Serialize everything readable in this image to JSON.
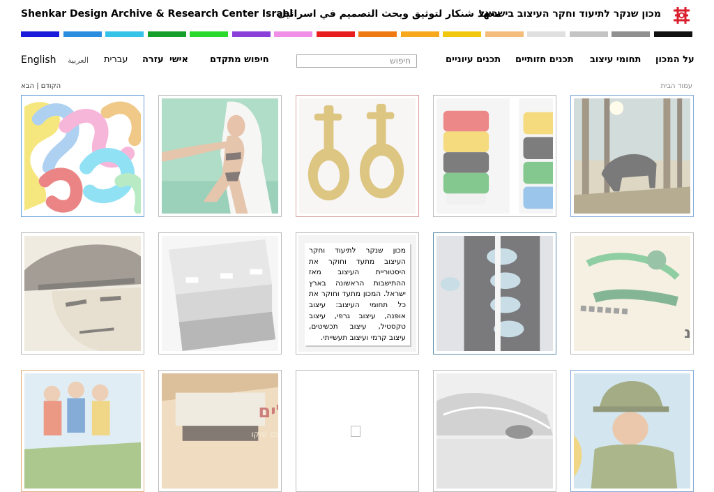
{
  "header": {
    "title_en": "Shenkar Design Archive & Research Center Israel",
    "title_ar": "معهد شنكار لتوثيق وبحث التصميم في اسرائيل",
    "title_he": "מכון שנקר לתיעוד וחקר העיצוב בישראל",
    "logo_icon": "shenkar-logo-icon",
    "logo_color": "#d81e2b"
  },
  "color_bar": [
    "#1a1adb",
    "#2b8de0",
    "#35c3e8",
    "#15a02c",
    "#2bd92b",
    "#8a3fd9",
    "#f08ee8",
    "#e81e1e",
    "#f07a12",
    "#f7a81c",
    "#f2c80f",
    "#f5bd7b",
    "#e0e0e0",
    "#c4c4c4",
    "#909090",
    "#111111"
  ],
  "nav": {
    "languages": [
      "English",
      "العربية",
      "עברית"
    ],
    "help": "עזרה",
    "personal": "אישי",
    "advanced_search": "חיפוש מתקדם",
    "search_placeholder": "חיפוש",
    "menu": [
      "על המכון",
      "תחומי עיצוב",
      "תכנים חזותיים",
      "תכנים עיוניים"
    ]
  },
  "pager": {
    "prev": "הקודם",
    "separator": "|",
    "next": "הבא"
  },
  "breadcrumb": "עמוד הבית",
  "intro_text": "מכון שנקר לתיעוד וחקר העיצוב מתעד וחוקר את היסטוריית העיצוב מאז ההתישבות הראשונה בארץ ישראל. המכון מתעד וחוקר את כל תחומי העיצוב: עיצוב אופנה, עיצוב גרפי, עיצוב טקסטיל, עיצוב תכשיטים, עיצוב קרמי ועיצוב תעשייתי.",
  "poster_text_1": "היה כבול לשונ",
  "poster_text_2": "ופלים",
  "poster_text_3": "בטעם שוקו"
}
